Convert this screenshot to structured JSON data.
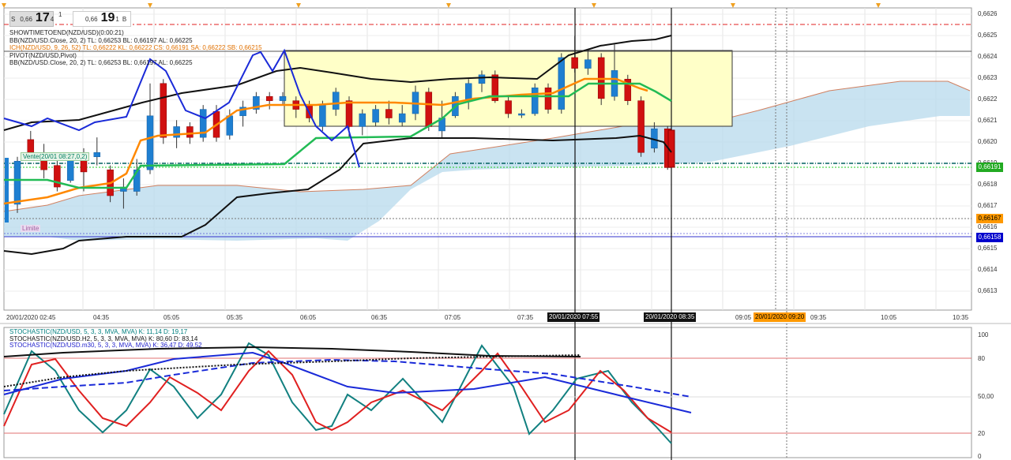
{
  "quote": {
    "sell_prefix": "0,66",
    "sell_big": "17",
    "sell_sup": "4",
    "spread": "1",
    "buy_prefix": "0,66",
    "buy_big": "19",
    "buy_sup": "1",
    "sell_letter": "S",
    "buy_letter": "B"
  },
  "indicators": [
    {
      "text": "SHOWTIMETOEND(NZD/USD)(0:00:21)",
      "color": "#222222"
    },
    {
      "text": "BB(NZD/USD.Close, 20, 2)  TL: 0,66253  BL: 0,66197  AL: 0,66225",
      "color": "#222222"
    },
    {
      "text": "ICH(NZD/USD, 9, 26, 52)  TL: 0,66222  KL: 0,66222  CS: 0,66191  SA: 0,66222  SB: 0,66215",
      "color": "#e07000"
    },
    {
      "text": "PIVOT(NZD/USD,Pivot)",
      "color": "#222222"
    },
    {
      "text": "BB(NZD/USD.Close, 20, 2)  TL: 0,66253  BL: 0,66197  AL: 0,66225",
      "color": "#222222"
    }
  ],
  "price_axis": [
    "0,6626",
    "0,6625",
    "0,6624",
    "0,6623",
    "0,6622",
    "0,6621",
    "0,6620",
    "0,6619",
    "0,6618",
    "0,6617",
    "0,6616",
    "0,6615",
    "0,6614",
    "0,6613"
  ],
  "price_badges": [
    {
      "text": "0,66191",
      "bg": "#22aa22",
      "fg": "#ffffff"
    },
    {
      "text": "0,66167",
      "bg": "#ff9900",
      "fg": "#000000"
    },
    {
      "text": "0,66158",
      "bg": "#0000cc",
      "fg": "#ffffff"
    }
  ],
  "time_axis": [
    "20/01/2020 02:45",
    "04:35",
    "05:05",
    "05:35",
    "06:05",
    "06:35",
    "07:05",
    "07:35",
    "20/01/2020 07:55",
    "20/01/2020 08:35",
    "09:05",
    "20/01/2020 09:20",
    "09:35",
    "10:05",
    "10:35"
  ],
  "order_labels": {
    "sell": "Vente(20/01 08:27,0,2)",
    "limit": "Limite"
  },
  "stochastics": [
    {
      "text": "STOCHASTIC(NZD/USD, 5, 3, 3, MVA, MVA)  K: 11,14  D: 19,17",
      "color": "#008080"
    },
    {
      "text": "STOCHASTIC(NZD/USD.H2, 5, 3, 3, MVA, MVA)  K: 80,60  D: 83,14",
      "color": "#111111"
    },
    {
      "text": "STOCHASTIC(NZD/USD.m30, 5, 3, 3, MVA, MVA)  K: 36,47  D: 49,52",
      "color": "#2222cc"
    }
  ],
  "stoch_axis": [
    "100",
    "80",
    "50,00",
    "20",
    "0"
  ],
  "colors": {
    "bull": "#1e7fd1",
    "bear": "#d01010",
    "kijun": "#22bb55",
    "tenkan": "#ff8800",
    "cloud": "#bcdcee",
    "box": "#ffffc8"
  },
  "chart_data": {
    "type": "candlestick",
    "symbol": "NZD/USD",
    "ylim": [
      0.66125,
      0.66265
    ],
    "candles": [
      {
        "o": 0.66174,
        "c": 0.66194,
        "h": 0.66196,
        "l": 0.6617
      },
      {
        "o": 0.66204,
        "c": 0.66198,
        "h": 0.66208,
        "l": 0.66196
      },
      {
        "o": 0.66198,
        "c": 0.6619,
        "h": 0.66202,
        "l": 0.66186
      },
      {
        "o": 0.66192,
        "c": 0.66182,
        "h": 0.66196,
        "l": 0.6618
      },
      {
        "o": 0.66185,
        "c": 0.66195,
        "h": 0.66198,
        "l": 0.66184
      },
      {
        "o": 0.66197,
        "c": 0.66189,
        "h": 0.662,
        "l": 0.6618
      },
      {
        "o": 0.66196,
        "c": 0.66198,
        "h": 0.66205,
        "l": 0.66192
      },
      {
        "o": 0.6619,
        "c": 0.66178,
        "h": 0.66192,
        "l": 0.66175
      },
      {
        "o": 0.6618,
        "c": 0.66182,
        "h": 0.66186,
        "l": 0.66172
      },
      {
        "o": 0.6618,
        "c": 0.6619,
        "h": 0.66195,
        "l": 0.66178
      },
      {
        "o": 0.6619,
        "c": 0.66215,
        "h": 0.6623,
        "l": 0.66188
      },
      {
        "o": 0.6623,
        "c": 0.66205,
        "h": 0.66232,
        "l": 0.66202
      },
      {
        "o": 0.66205,
        "c": 0.6621,
        "h": 0.66213,
        "l": 0.662
      },
      {
        "o": 0.6621,
        "c": 0.66205,
        "h": 0.66212,
        "l": 0.66202
      },
      {
        "o": 0.66205,
        "c": 0.66218,
        "h": 0.6622,
        "l": 0.66203
      },
      {
        "o": 0.66217,
        "c": 0.66205,
        "h": 0.6622,
        "l": 0.66203
      },
      {
        "o": 0.66206,
        "c": 0.66215,
        "h": 0.66218,
        "l": 0.66204
      },
      {
        "o": 0.66215,
        "c": 0.66219,
        "h": 0.66222,
        "l": 0.6621
      },
      {
        "o": 0.66218,
        "c": 0.66224,
        "h": 0.66226,
        "l": 0.66216
      },
      {
        "o": 0.66224,
        "c": 0.66222,
        "h": 0.66226,
        "l": 0.66218
      },
      {
        "o": 0.66222,
        "c": 0.66224,
        "h": 0.66226,
        "l": 0.6622
      },
      {
        "o": 0.66222,
        "c": 0.66218,
        "h": 0.66224,
        "l": 0.66214
      },
      {
        "o": 0.6622,
        "c": 0.66214,
        "h": 0.66222,
        "l": 0.66212
      },
      {
        "o": 0.6621,
        "c": 0.6622,
        "h": 0.66222,
        "l": 0.66208
      },
      {
        "o": 0.66218,
        "c": 0.66226,
        "h": 0.66228,
        "l": 0.66215
      },
      {
        "o": 0.66222,
        "c": 0.6621,
        "h": 0.66224,
        "l": 0.66205
      },
      {
        "o": 0.6621,
        "c": 0.66216,
        "h": 0.66218,
        "l": 0.66206
      },
      {
        "o": 0.66212,
        "c": 0.66218,
        "h": 0.6622,
        "l": 0.6621
      },
      {
        "o": 0.66218,
        "c": 0.66214,
        "h": 0.66222,
        "l": 0.66211
      },
      {
        "o": 0.66212,
        "c": 0.66216,
        "h": 0.6622,
        "l": 0.6621
      },
      {
        "o": 0.66216,
        "c": 0.66226,
        "h": 0.66229,
        "l": 0.66213
      },
      {
        "o": 0.66226,
        "c": 0.6621,
        "h": 0.66228,
        "l": 0.66208
      },
      {
        "o": 0.66208,
        "c": 0.66214,
        "h": 0.66222,
        "l": 0.66205
      },
      {
        "o": 0.66215,
        "c": 0.66224,
        "h": 0.66226,
        "l": 0.66214
      },
      {
        "o": 0.66222,
        "c": 0.6623,
        "h": 0.66232,
        "l": 0.66218
      },
      {
        "o": 0.6623,
        "c": 0.66234,
        "h": 0.66236,
        "l": 0.66226
      },
      {
        "o": 0.66234,
        "c": 0.66222,
        "h": 0.66236,
        "l": 0.66221
      },
      {
        "o": 0.66222,
        "c": 0.66216,
        "h": 0.66224,
        "l": 0.66214
      },
      {
        "o": 0.66216,
        "c": 0.66216,
        "h": 0.66218,
        "l": 0.66214
      },
      {
        "o": 0.66216,
        "c": 0.66228,
        "h": 0.6623,
        "l": 0.66215
      },
      {
        "o": 0.66228,
        "c": 0.66218,
        "h": 0.6623,
        "l": 0.66216
      },
      {
        "o": 0.66218,
        "c": 0.66242,
        "h": 0.66244,
        "l": 0.66216
      },
      {
        "o": 0.66242,
        "c": 0.66237,
        "h": 0.66252,
        "l": 0.66235
      },
      {
        "o": 0.66237,
        "c": 0.66241,
        "h": 0.66246,
        "l": 0.66234
      },
      {
        "o": 0.66242,
        "c": 0.66223,
        "h": 0.66244,
        "l": 0.6622
      },
      {
        "o": 0.66224,
        "c": 0.66236,
        "h": 0.66248,
        "l": 0.66222
      },
      {
        "o": 0.66232,
        "c": 0.66222,
        "h": 0.66234,
        "l": 0.6622
      },
      {
        "o": 0.66222,
        "c": 0.66198,
        "h": 0.66224,
        "l": 0.66196
      },
      {
        "o": 0.662,
        "c": 0.66209,
        "h": 0.66212,
        "l": 0.66198
      },
      {
        "o": 0.66209,
        "c": 0.66191,
        "h": 0.6621,
        "l": 0.6619
      }
    ]
  }
}
